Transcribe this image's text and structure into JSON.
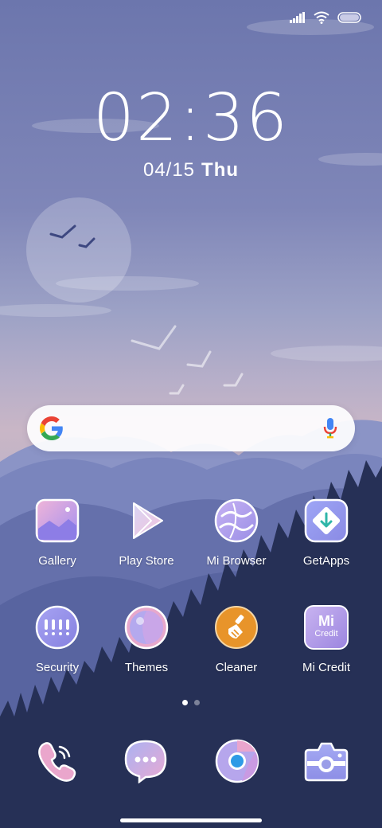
{
  "status_bar": {
    "signal_icon": "signal-icon",
    "wifi_icon": "wifi-icon",
    "battery_icon": "battery-icon"
  },
  "lock": {
    "time_hours": "02",
    "time_sep": ":",
    "time_minutes": "36",
    "date": "04/15",
    "day": "Thu"
  },
  "search": {
    "logo_icon": "google-g-icon",
    "mic_icon": "microphone-icon"
  },
  "apps": [
    {
      "label": "Gallery",
      "icon": "gallery-icon"
    },
    {
      "label": "Play Store",
      "icon": "play-store-icon"
    },
    {
      "label": "Mi Browser",
      "icon": "browser-icon"
    },
    {
      "label": "GetApps",
      "icon": "getapps-icon"
    },
    {
      "label": "Security",
      "icon": "security-icon"
    },
    {
      "label": "Themes",
      "icon": "themes-icon"
    },
    {
      "label": "Cleaner",
      "icon": "cleaner-icon"
    },
    {
      "label": "Mi Credit",
      "icon": "mi-credit-icon"
    }
  ],
  "mi_credit_icon_text": {
    "logo": "Mi",
    "sub": "Credit"
  },
  "page_indicator": {
    "pages": 2,
    "active": 1
  },
  "dock": [
    {
      "icon": "phone-icon"
    },
    {
      "icon": "messages-icon"
    },
    {
      "icon": "chrome-icon"
    },
    {
      "icon": "camera-icon"
    }
  ],
  "colors": {
    "sky_top": "#6c76ad",
    "sky_bottom": "#c9b6c6",
    "mountain_light": "#7b86bd",
    "mountain_mid": "#5a65a0",
    "forest_dark": "#263056",
    "accent_orange": "#e8942a",
    "icon_lavender": "#9b9fe6"
  }
}
